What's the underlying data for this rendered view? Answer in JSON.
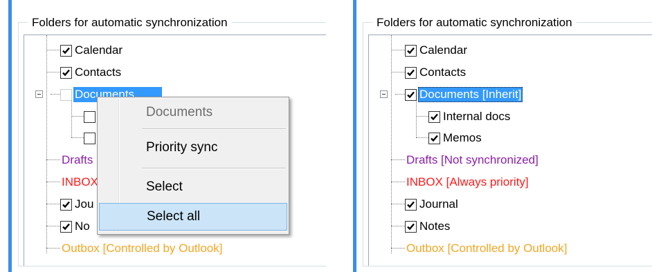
{
  "colors": {
    "accent": "#3c8ee6",
    "selection": "#3399ff",
    "not_synchronized": "#8b1fa8",
    "always_priority": "#ff1a1a",
    "controlled_by_outlook": "#f5a623",
    "menu_hover": "#cce4f7"
  },
  "left_panel": {
    "group_title": "Folders for automatic synchronization",
    "items": [
      {
        "label": "Calendar",
        "checked": true
      },
      {
        "label": "Contacts",
        "checked": true
      },
      {
        "label": "Documents",
        "checked": false,
        "selected": true
      },
      {
        "label": "",
        "checked": false
      },
      {
        "label": "",
        "checked": false
      },
      {
        "label": "Drafts",
        "checked": false
      },
      {
        "label": "INBOX",
        "checked": false
      },
      {
        "label": "Jou",
        "checked": true
      },
      {
        "label": "No",
        "checked": true
      },
      {
        "label": "Outbox [Controlled by Outlook]",
        "checked": false
      }
    ],
    "context_menu": {
      "header": "Documents",
      "items": [
        "Priority sync",
        "Select",
        "Select all"
      ],
      "highlighted": "Select all"
    }
  },
  "right_panel": {
    "group_title": "Folders for automatic synchronization",
    "items": [
      {
        "label": "Calendar",
        "checked": true
      },
      {
        "label": "Contacts",
        "checked": true
      },
      {
        "label": "Documents [Inherit]",
        "checked": true,
        "selected": true
      },
      {
        "label": "Internal docs",
        "checked": true
      },
      {
        "label": "Memos",
        "checked": true
      },
      {
        "label": "Drafts [Not synchronized]",
        "checked": false
      },
      {
        "label": "INBOX [Always priority]",
        "checked": false
      },
      {
        "label": "Journal",
        "checked": true
      },
      {
        "label": "Notes",
        "checked": true
      },
      {
        "label": "Outbox [Controlled by Outlook]",
        "checked": false
      }
    ]
  }
}
